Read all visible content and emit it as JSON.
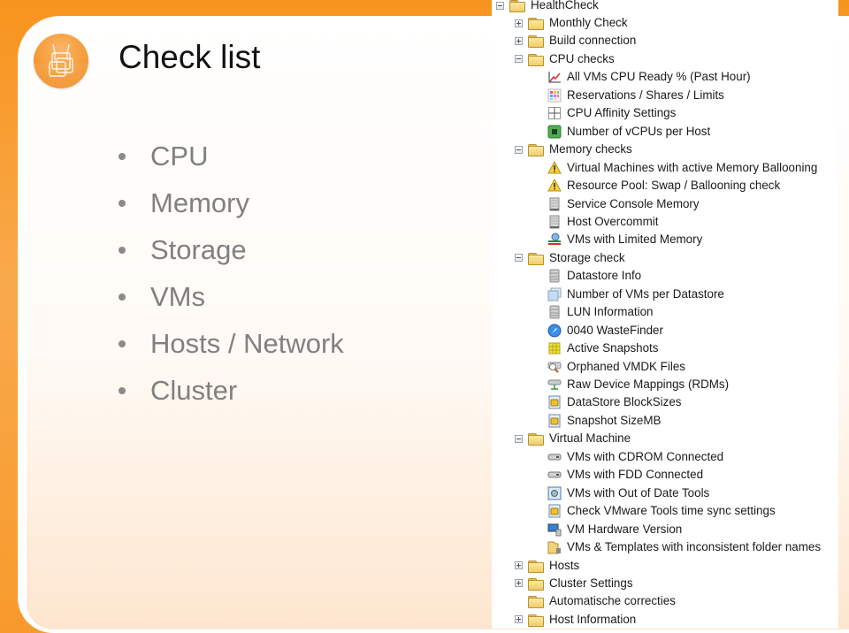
{
  "slide": {
    "title": "Check list",
    "logo_icon": "network-logo-icon",
    "accent_color": "#f7941d",
    "bullets": [
      "CPU",
      "Memory",
      "Storage",
      "VMs",
      "Hosts / Network",
      "Cluster"
    ]
  },
  "tree": {
    "root": {
      "label": "HealthCheck",
      "state": "expanded"
    },
    "nodes": [
      {
        "label": "Monthly Check",
        "type": "folder",
        "state": "collapsed"
      },
      {
        "label": "Build connection",
        "type": "folder",
        "state": "collapsed"
      },
      {
        "label": "CPU checks",
        "type": "folder",
        "state": "expanded"
      },
      {
        "label": "All VMs CPU Ready % (Past Hour)",
        "type": "item",
        "icon": "line-chart-icon"
      },
      {
        "label": "Reservations / Shares / Limits",
        "type": "item",
        "icon": "color-grid-icon"
      },
      {
        "label": "CPU Affinity Settings",
        "type": "item",
        "icon": "table-grid-icon"
      },
      {
        "label": "Number of vCPUs per Host",
        "type": "item",
        "icon": "cpu-chip-icon"
      },
      {
        "label": "Memory checks",
        "type": "folder",
        "state": "expanded"
      },
      {
        "label": "Virtual Machines with active Memory Ballooning",
        "type": "item",
        "icon": "warning-icon"
      },
      {
        "label": "Resource Pool:  Swap / Ballooning check",
        "type": "item",
        "icon": "warning-icon"
      },
      {
        "label": "Service Console Memory",
        "type": "item",
        "icon": "server-icon"
      },
      {
        "label": "Host Overcommit",
        "type": "item",
        "icon": "server-icon"
      },
      {
        "label": "VMs with Limited Memory",
        "type": "item",
        "icon": "memory-limit-icon"
      },
      {
        "label": "Storage check",
        "type": "folder",
        "state": "expanded"
      },
      {
        "label": "Datastore Info",
        "type": "item",
        "icon": "database-icon"
      },
      {
        "label": "Number of VMs per Datastore",
        "type": "item",
        "icon": "stacked-vms-icon"
      },
      {
        "label": "LUN Information",
        "type": "item",
        "icon": "database-icon"
      },
      {
        "label": "0040 WasteFinder",
        "type": "item",
        "icon": "compass-icon"
      },
      {
        "label": "Active Snapshots",
        "type": "item",
        "icon": "snapshot-icon"
      },
      {
        "label": "Orphaned VMDK Files",
        "type": "item",
        "icon": "magnifier-icon"
      },
      {
        "label": "Raw Device Mappings (RDMs)",
        "type": "item",
        "icon": "network-drive-icon"
      },
      {
        "label": "DataStore BlockSizes",
        "type": "item",
        "icon": "script-icon"
      },
      {
        "label": "Snapshot SizeMB",
        "type": "item",
        "icon": "script-icon"
      },
      {
        "label": "Virtual Machine",
        "type": "folder",
        "state": "expanded"
      },
      {
        "label": "VMs with CDROM Connected",
        "type": "item",
        "icon": "drive-icon"
      },
      {
        "label": "VMs with FDD Connected",
        "type": "item",
        "icon": "drive-icon"
      },
      {
        "label": "VMs with Out of Date Tools",
        "type": "item",
        "icon": "tools-icon"
      },
      {
        "label": "Check VMware Tools time sync settings",
        "type": "item",
        "icon": "script-icon"
      },
      {
        "label": "VM Hardware Version",
        "type": "item",
        "icon": "computer-icon"
      },
      {
        "label": "VMs & Templates with inconsistent folder names",
        "type": "item",
        "icon": "folder-vm-icon"
      },
      {
        "label": "Hosts",
        "type": "folder",
        "state": "collapsed"
      },
      {
        "label": "Cluster Settings",
        "type": "folder",
        "state": "collapsed"
      },
      {
        "label": "Automatische correcties",
        "type": "folder",
        "state": "leaf"
      },
      {
        "label": "Host Information",
        "type": "folder",
        "state": "collapsed"
      }
    ]
  }
}
